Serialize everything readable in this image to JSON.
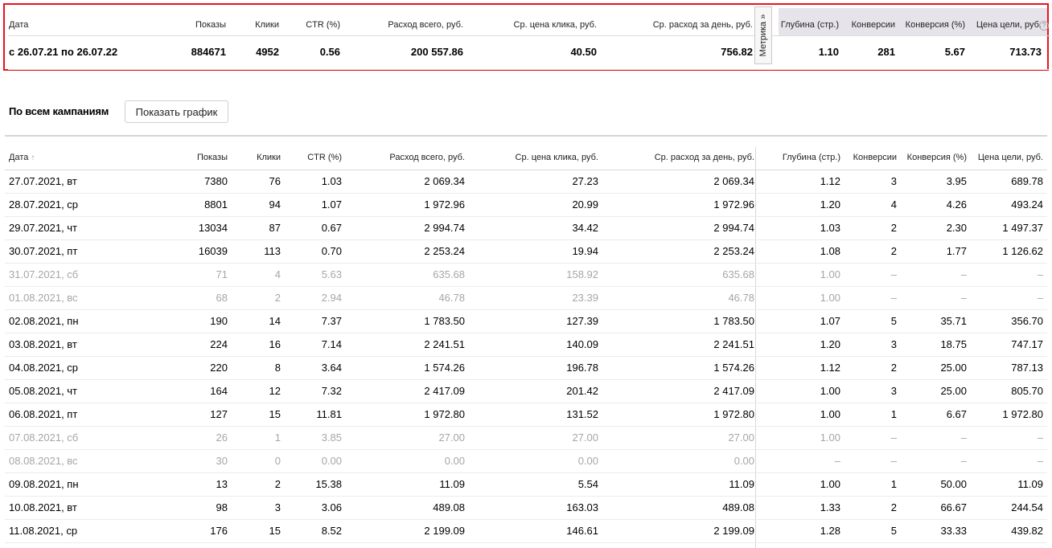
{
  "summary": {
    "headers": {
      "date": "Дата",
      "shows": "Показы",
      "clicks": "Клики",
      "ctr": "CTR (%)",
      "spend": "Расход всего, руб.",
      "cpc": "Ср. цена клика, руб.",
      "daily": "Ср. расход за день, руб.",
      "depth": "Глубина (стр.)",
      "conversions": "Конверсии",
      "conv_rate": "Конверсия (%)",
      "goal_price": "Цена цели, руб."
    },
    "values": {
      "date": "с 26.07.21 по 26.07.22",
      "shows": "884671",
      "clicks": "4952",
      "ctr": "0.56",
      "spend": "200 557.86",
      "cpc": "40.50",
      "daily": "756.82",
      "depth": "1.10",
      "conversions": "281",
      "conv_rate": "5.67",
      "goal_price": "713.73"
    },
    "metrika_tab": "Метрика »",
    "help_icon": "?"
  },
  "campaign": {
    "label": "По всем кампаниям",
    "show_chart_button": "Показать график"
  },
  "table": {
    "headers": {
      "date": "Дата",
      "sort_icon": "↑",
      "shows": "Показы",
      "clicks": "Клики",
      "ctr": "CTR (%)",
      "spend": "Расход всего, руб.",
      "cpc": "Ср. цена клика, руб.",
      "daily": "Ср. расход за день, руб.",
      "depth": "Глубина (стр.)",
      "conversions": "Конверсии",
      "conv_rate": "Конверсия (%)",
      "goal_price": "Цена цели, руб."
    },
    "rows": [
      {
        "date": "27.07.2021, вт",
        "shows": "7380",
        "clicks": "76",
        "ctr": "1.03",
        "spend": "2 069.34",
        "cpc": "27.23",
        "daily": "2 069.34",
        "depth": "1.12",
        "conversions": "3",
        "conv_rate": "3.95",
        "goal_price": "689.78",
        "weekend": false
      },
      {
        "date": "28.07.2021, ср",
        "shows": "8801",
        "clicks": "94",
        "ctr": "1.07",
        "spend": "1 972.96",
        "cpc": "20.99",
        "daily": "1 972.96",
        "depth": "1.20",
        "conversions": "4",
        "conv_rate": "4.26",
        "goal_price": "493.24",
        "weekend": false
      },
      {
        "date": "29.07.2021, чт",
        "shows": "13034",
        "clicks": "87",
        "ctr": "0.67",
        "spend": "2 994.74",
        "cpc": "34.42",
        "daily": "2 994.74",
        "depth": "1.03",
        "conversions": "2",
        "conv_rate": "2.30",
        "goal_price": "1 497.37",
        "weekend": false
      },
      {
        "date": "30.07.2021, пт",
        "shows": "16039",
        "clicks": "113",
        "ctr": "0.70",
        "spend": "2 253.24",
        "cpc": "19.94",
        "daily": "2 253.24",
        "depth": "1.08",
        "conversions": "2",
        "conv_rate": "1.77",
        "goal_price": "1 126.62",
        "weekend": false
      },
      {
        "date": "31.07.2021, сб",
        "shows": "71",
        "clicks": "4",
        "ctr": "5.63",
        "spend": "635.68",
        "cpc": "158.92",
        "daily": "635.68",
        "depth": "1.00",
        "conversions": "–",
        "conv_rate": "–",
        "goal_price": "–",
        "weekend": true
      },
      {
        "date": "01.08.2021, вс",
        "shows": "68",
        "clicks": "2",
        "ctr": "2.94",
        "spend": "46.78",
        "cpc": "23.39",
        "daily": "46.78",
        "depth": "1.00",
        "conversions": "–",
        "conv_rate": "–",
        "goal_price": "–",
        "weekend": true
      },
      {
        "date": "02.08.2021, пн",
        "shows": "190",
        "clicks": "14",
        "ctr": "7.37",
        "spend": "1 783.50",
        "cpc": "127.39",
        "daily": "1 783.50",
        "depth": "1.07",
        "conversions": "5",
        "conv_rate": "35.71",
        "goal_price": "356.70",
        "weekend": false
      },
      {
        "date": "03.08.2021, вт",
        "shows": "224",
        "clicks": "16",
        "ctr": "7.14",
        "spend": "2 241.51",
        "cpc": "140.09",
        "daily": "2 241.51",
        "depth": "1.20",
        "conversions": "3",
        "conv_rate": "18.75",
        "goal_price": "747.17",
        "weekend": false
      },
      {
        "date": "04.08.2021, ср",
        "shows": "220",
        "clicks": "8",
        "ctr": "3.64",
        "spend": "1 574.26",
        "cpc": "196.78",
        "daily": "1 574.26",
        "depth": "1.12",
        "conversions": "2",
        "conv_rate": "25.00",
        "goal_price": "787.13",
        "weekend": false
      },
      {
        "date": "05.08.2021, чт",
        "shows": "164",
        "clicks": "12",
        "ctr": "7.32",
        "spend": "2 417.09",
        "cpc": "201.42",
        "daily": "2 417.09",
        "depth": "1.00",
        "conversions": "3",
        "conv_rate": "25.00",
        "goal_price": "805.70",
        "weekend": false
      },
      {
        "date": "06.08.2021, пт",
        "shows": "127",
        "clicks": "15",
        "ctr": "11.81",
        "spend": "1 972.80",
        "cpc": "131.52",
        "daily": "1 972.80",
        "depth": "1.00",
        "conversions": "1",
        "conv_rate": "6.67",
        "goal_price": "1 972.80",
        "weekend": false
      },
      {
        "date": "07.08.2021, сб",
        "shows": "26",
        "clicks": "1",
        "ctr": "3.85",
        "spend": "27.00",
        "cpc": "27.00",
        "daily": "27.00",
        "depth": "1.00",
        "conversions": "–",
        "conv_rate": "–",
        "goal_price": "–",
        "weekend": true
      },
      {
        "date": "08.08.2021, вс",
        "shows": "30",
        "clicks": "0",
        "ctr": "0.00",
        "spend": "0.00",
        "cpc": "0.00",
        "daily": "0.00",
        "depth": "–",
        "conversions": "–",
        "conv_rate": "–",
        "goal_price": "–",
        "weekend": true
      },
      {
        "date": "09.08.2021, пн",
        "shows": "13",
        "clicks": "2",
        "ctr": "15.38",
        "spend": "11.09",
        "cpc": "5.54",
        "daily": "11.09",
        "depth": "1.00",
        "conversions": "1",
        "conv_rate": "50.00",
        "goal_price": "11.09",
        "weekend": false
      },
      {
        "date": "10.08.2021, вт",
        "shows": "98",
        "clicks": "3",
        "ctr": "3.06",
        "spend": "489.08",
        "cpc": "163.03",
        "daily": "489.08",
        "depth": "1.33",
        "conversions": "2",
        "conv_rate": "66.67",
        "goal_price": "244.54",
        "weekend": false
      },
      {
        "date": "11.08.2021, ср",
        "shows": "176",
        "clicks": "15",
        "ctr": "8.52",
        "spend": "2 199.09",
        "cpc": "146.61",
        "daily": "2 199.09",
        "depth": "1.28",
        "conversions": "5",
        "conv_rate": "33.33",
        "goal_price": "439.82",
        "weekend": false
      }
    ]
  }
}
